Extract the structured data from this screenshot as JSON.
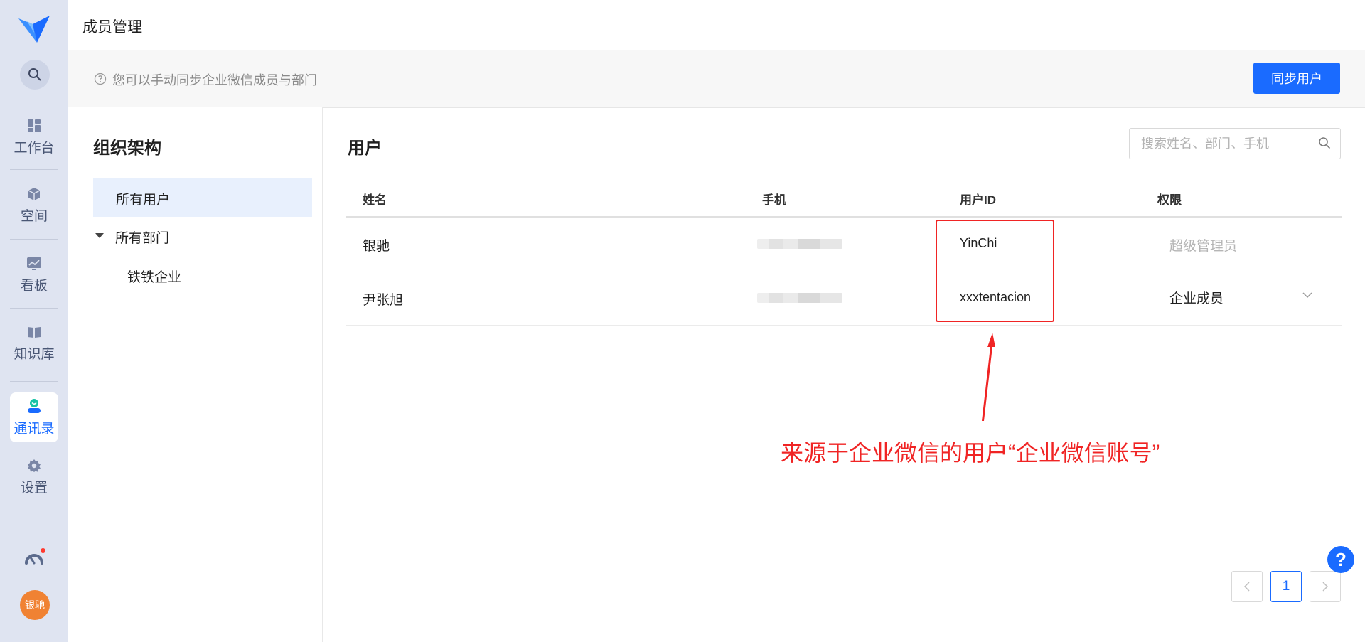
{
  "header": {
    "title": "成员管理"
  },
  "infobar": {
    "tip": "您可以手动同步企业微信成员与部门",
    "sync_label": "同步用户"
  },
  "nav": {
    "items": [
      {
        "label": "工作台",
        "icon": "dashboard-icon"
      },
      {
        "label": "空间",
        "icon": "cube-icon"
      },
      {
        "label": "看板",
        "icon": "chart-board-icon"
      },
      {
        "label": "知识库",
        "icon": "book-icon"
      },
      {
        "label": "通讯录",
        "icon": "contacts-icon"
      },
      {
        "label": "设置",
        "icon": "gear-icon"
      }
    ],
    "active": "通讯录",
    "avatar": "银驰"
  },
  "org": {
    "title": "组织架构",
    "all_users": "所有用户",
    "all_departments": "所有部门",
    "departments": [
      "铁铁企业"
    ]
  },
  "users": {
    "title": "用户",
    "search_placeholder": "搜索姓名、部门、手机",
    "columns": {
      "name": "姓名",
      "phone": "手机",
      "user_id": "用户ID",
      "role": "权限"
    },
    "rows": [
      {
        "name": "银驰",
        "user_id": "YinChi",
        "role": "超级管理员"
      },
      {
        "name": "尹张旭",
        "user_id": "xxxtentacion",
        "role": "企业成员"
      }
    ]
  },
  "annotation": {
    "text": "来源于企业微信的用户“企业微信账号”",
    "color": "#f02424"
  },
  "pagination": {
    "current": "1"
  },
  "help": {
    "label": "?"
  },
  "colors": {
    "accent": "#1a6bff",
    "rail_bg": "#dfe4f1",
    "avatar_bg": "#f08233"
  }
}
